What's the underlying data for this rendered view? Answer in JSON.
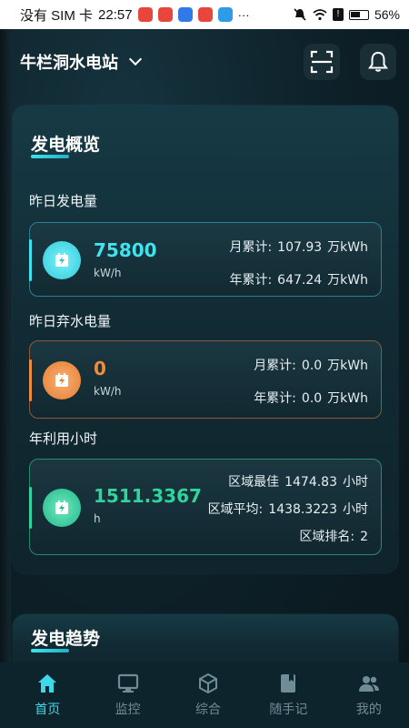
{
  "status_bar": {
    "carrier": "没有 SIM 卡",
    "time": "22:57",
    "battery": "56%"
  },
  "header": {
    "station_name": "牛栏洞水电站",
    "icons": [
      "chevron-down-icon",
      "scan-icon",
      "bell-icon"
    ]
  },
  "overview": {
    "title": "发电概览",
    "yesterday_gen": {
      "label": "昨日发电量",
      "value": "75800",
      "unit": "kW/h",
      "month_label": "月累计:",
      "month_value": "107.93",
      "month_unit": "万kWh",
      "year_label": "年累计:",
      "year_value": "647.24",
      "year_unit": "万kWh",
      "color": "#3fe3ef"
    },
    "yesterday_spill": {
      "label": "昨日弃水电量",
      "value": "0",
      "unit": "kW/h",
      "month_label": "月累计:",
      "month_value": "0.0",
      "month_unit": "万kWh",
      "year_label": "年累计:",
      "year_value": "0.0",
      "year_unit": "万kWh",
      "color": "#f08a3c"
    },
    "annual_hours": {
      "label": "年利用小时",
      "value": "1511.3367",
      "unit": "h",
      "best_label": "区域最佳",
      "best_value": "1474.83",
      "best_unit": "小时",
      "avg_label": "区域平均:",
      "avg_value": "1438.3223",
      "avg_unit": "小时",
      "rank_label": "区域排名:",
      "rank_value": "2",
      "color": "#2fd59c"
    }
  },
  "trend": {
    "title": "发电趋势"
  },
  "tabs": [
    {
      "label": "首页",
      "icon": "home-icon",
      "active": true
    },
    {
      "label": "监控",
      "icon": "monitor-icon",
      "active": false
    },
    {
      "label": "综合",
      "icon": "cube-icon",
      "active": false
    },
    {
      "label": "随手记",
      "icon": "notebook-icon",
      "active": false
    },
    {
      "label": "我的",
      "icon": "users-icon",
      "active": false
    }
  ]
}
